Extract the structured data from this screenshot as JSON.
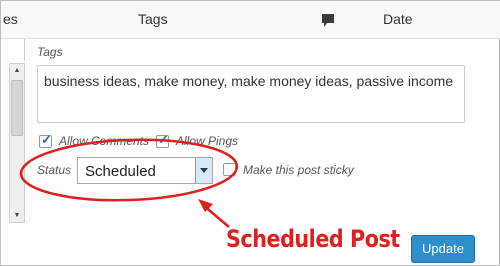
{
  "header": {
    "col_partial": "es",
    "col_tags": "Tags",
    "col_comments_icon": "comment-icon",
    "col_date": "Date"
  },
  "tags": {
    "label": "Tags",
    "value": "business ideas, make money, make money ideas, passive income"
  },
  "options": {
    "allow_comments_label": "Allow Comments",
    "allow_comments_checked": true,
    "allow_pings_label": "Allow Pings",
    "allow_pings_checked": true,
    "sticky_label": "Make this post sticky",
    "sticky_checked": false
  },
  "status": {
    "label": "Status",
    "selected": "Scheduled"
  },
  "annotation": {
    "text": "Scheduled Post",
    "color": "#e02020"
  },
  "actions": {
    "update_label": "Update",
    "update_color": "#2e8fcc"
  }
}
